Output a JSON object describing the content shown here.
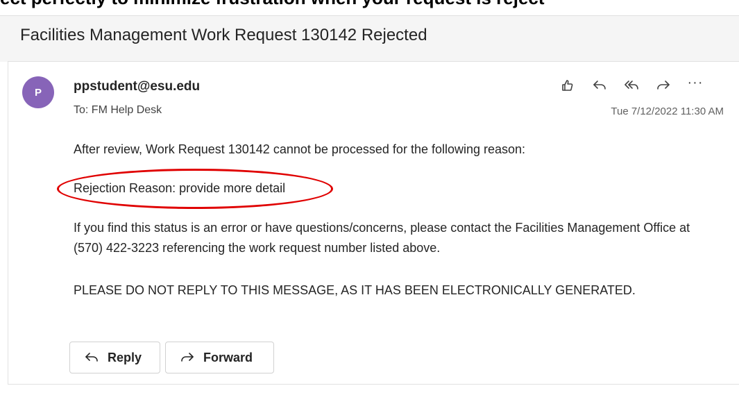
{
  "header": {
    "top_heading": "ect perfectly to minimize frustration when your request is reject",
    "subject": "Facilities Management Work Request 130142 Rejected"
  },
  "message": {
    "avatar_initial": "P",
    "avatar_color": "#8764b8",
    "sender": "ppstudent@esu.edu",
    "to_line": "To:  FM Help Desk",
    "timestamp": "Tue 7/12/2022 11:30 AM",
    "actions": [
      {
        "name": "like-icon"
      },
      {
        "name": "reply-icon"
      },
      {
        "name": "reply-all-icon"
      },
      {
        "name": "forward-icon"
      },
      {
        "name": "more-icon",
        "label": "···"
      }
    ],
    "body": {
      "p1": "After review, Work Request 130142 cannot be processed for the following reason:",
      "p2": "Rejection Reason: provide more detail",
      "p3": "If you find this status is an error or have questions/concerns, please contact the Facilities Management Office at (570) 422-3223 referencing the work request number listed above.",
      "p4": "PLEASE DO NOT REPLY TO THIS MESSAGE, AS IT HAS BEEN ELECTRONICALLY GENERATED."
    }
  },
  "footer_buttons": {
    "reply_label": "Reply",
    "forward_label": "Forward"
  },
  "annotation_color": "#e00000"
}
